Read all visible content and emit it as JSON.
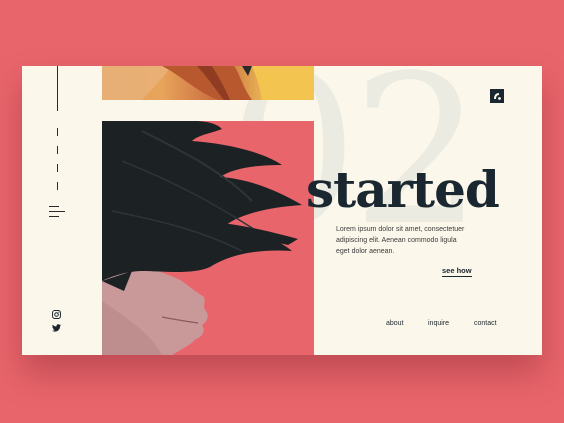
{
  "hero": {
    "number": "02",
    "title": "started",
    "body": "Lorem ipsum dolor sit amet, consectetuer adipiscing elit. Aenean commodo ligula eget dolor aenean.",
    "cta_label": "see how"
  },
  "nav": {
    "about": "about",
    "inquire": "inquire",
    "contact": "contact"
  },
  "icons": {
    "badge": "logo-badge-icon",
    "menu": "hamburger-menu-icon",
    "instagram": "instagram-icon",
    "twitter": "twitter-icon"
  },
  "colors": {
    "background": "#e8656b",
    "card": "#fbf7ea",
    "ink": "#1b2730",
    "accent": "#e8656b"
  }
}
